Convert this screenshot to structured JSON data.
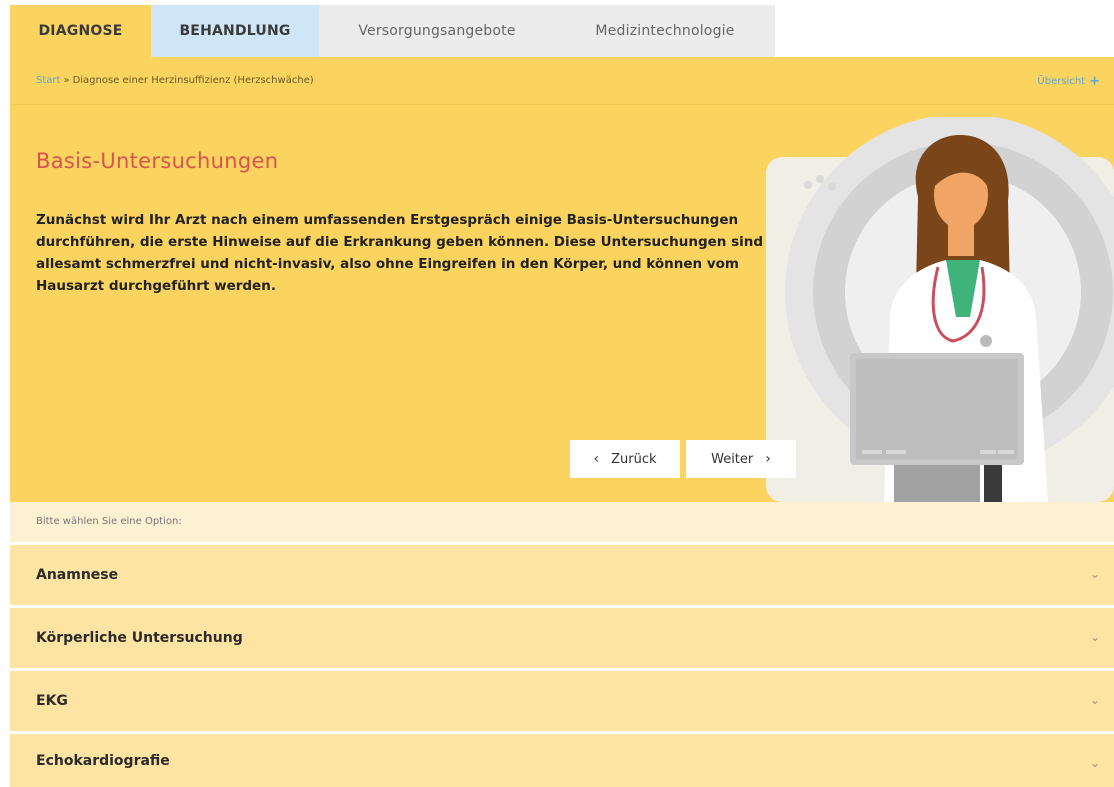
{
  "tabs": [
    {
      "label": "DIAGNOSE"
    },
    {
      "label": "BEHANDLUNG"
    },
    {
      "label": "Versorgungsangebote"
    },
    {
      "label": "Medizintechnologie"
    }
  ],
  "breadcrumb": {
    "start": "Start",
    "separator": "»",
    "current": "Diagnose einer Herzinsuffizienz (Herzschwäche)",
    "overview": "Übersicht",
    "overview_icon": "+"
  },
  "hero": {
    "title": "Basis-Untersuchungen",
    "text": "Zunächst wird Ihr Arzt nach einem umfassenden Erstgespräch einige Basis-Untersuchungen durchführen, die erste Hinweise auf die Erkrankung geben können. Diese Untersuchungen sind allesamt schmerzfrei und nicht-invasiv, also ohne Eingreifen in den Körper, und können vom Hausarzt durchgeführt werden.",
    "back_label": "Zurück",
    "next_label": "Weiter",
    "back_icon": "‹",
    "next_icon": "›"
  },
  "options": {
    "prompt": "Bitte wählen Sie eine Option:",
    "items": [
      {
        "label": "Anamnese"
      },
      {
        "label": "Körperliche Untersuchung"
      },
      {
        "label": "EKG"
      },
      {
        "label": "Echokardiografie"
      }
    ],
    "chevron": "⌄"
  },
  "colors": {
    "accent_yellow": "#fbd35f",
    "tab_blue": "#cfe6f7",
    "title_red": "#d9534f",
    "link_blue": "#5aa6d6",
    "option_bg": "#fde4a3"
  }
}
